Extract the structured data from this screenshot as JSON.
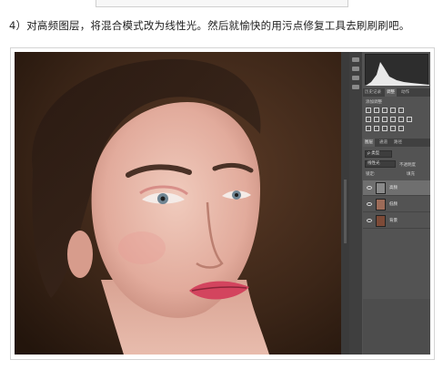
{
  "caption": "4）对高频图层，将混合模式改为线性光。然后就愉快的用污点修复工具去刷刷刷吧。",
  "panel": {
    "top_tabs": [
      "历史记录",
      "调整",
      "动作"
    ],
    "adjust_label": "添加调整",
    "layer_tabs": [
      "图层",
      "通道",
      "路径"
    ],
    "kind_filter": "ρ 类型",
    "blend_mode": "线性光",
    "opacity_label": "不透明度",
    "lock_label": "锁定:",
    "fill_label": "填充",
    "layers": [
      {
        "name": "高频",
        "selected": true
      },
      {
        "name": "低频",
        "selected": false
      },
      {
        "name": "背景",
        "selected": false
      }
    ]
  },
  "colors": {
    "panel_bg": "#535353",
    "selected_layer": "#6f6f6f",
    "photo_bg": "#3a2519"
  }
}
